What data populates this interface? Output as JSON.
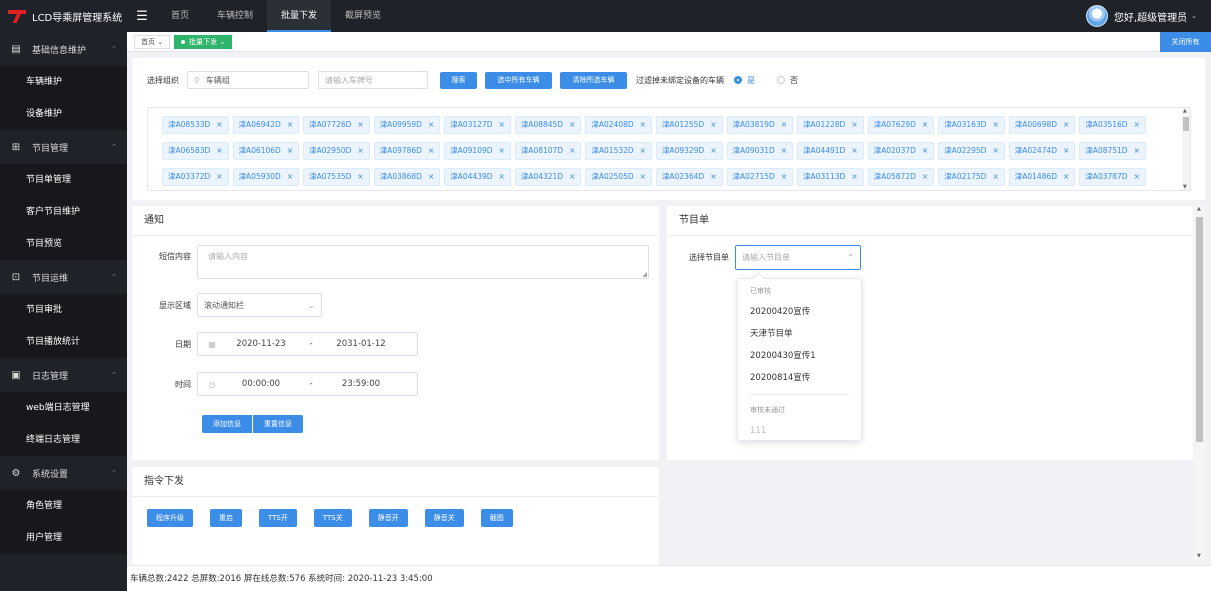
{
  "app": {
    "title": "LCD导乘屏管理系统"
  },
  "topnav": [
    "首页",
    "车辆控制",
    "批量下发",
    "截屏预览"
  ],
  "topnav_active": 2,
  "user": {
    "greeting": "您好,超级管理员"
  },
  "sidebar": [
    {
      "group": "基础信息维护",
      "icon": "document-icon",
      "items": [
        "车辆维护",
        "设备维护"
      ]
    },
    {
      "group": "节目管理",
      "icon": "bag-icon",
      "items": [
        "节目单管理",
        "客户节目维护",
        "节目预览"
      ]
    },
    {
      "group": "节目运维",
      "icon": "chart-icon",
      "items": [
        "节目审批",
        "节目播放统计"
      ]
    },
    {
      "group": "日志管理",
      "icon": "printer-icon",
      "items": [
        "web端日志管理",
        "终端日志管理"
      ]
    },
    {
      "group": "系统设置",
      "icon": "gear-icon",
      "items": [
        "角色管理",
        "用户管理"
      ]
    }
  ],
  "tabs": [
    {
      "label": "首页",
      "active": false
    },
    {
      "label": "批量下发",
      "active": true
    }
  ],
  "close_all": "关闭所有",
  "org": {
    "label": "选择组织",
    "org_value": "车辆组",
    "plate_placeholder": "请输入车牌号",
    "search_btn": "搜索",
    "select_all_btn": "选中所有车辆",
    "clear_btn": "清除所选车辆",
    "filter_label": "过滤掉未绑定设备的车辆",
    "yes": "是",
    "no": "否"
  },
  "vehicle_tags": [
    "津A08533D",
    "津A06942D",
    "津A07726D",
    "津A09959D",
    "津A03127D",
    "津A08845D",
    "津A02408D",
    "津A01255D",
    "津A03819D",
    "津A01228D",
    "津A07629D",
    "津A03163D",
    "津A00698D",
    "津A03516D",
    "津A06583D",
    "津A06106D",
    "津A02950D",
    "津A09786D",
    "津A09109D",
    "津A08107D",
    "津A01532D",
    "津A09329D",
    "津A09031D",
    "津A04491D",
    "津A02037D",
    "津A02295D",
    "津A02474D",
    "津A08751D",
    "津A03372D",
    "津A05930D",
    "津A07535D",
    "津A03868D",
    "津A04439D",
    "津A04321D",
    "津A02505D",
    "津A02364D",
    "津A02715D",
    "津A03113D",
    "津A05872D",
    "津A02175D",
    "津A01486D",
    "津A03787D"
  ],
  "notice": {
    "title": "通知",
    "sms_label": "短信内容",
    "sms_placeholder": "请输入内容",
    "area_label": "显示区域",
    "area_value": "滚动通知栏",
    "date_label": "日期",
    "date_start": "2020-11-23",
    "date_end": "2031-01-12",
    "time_label": "时间",
    "time_start": "00:00:00",
    "time_end": "23:59:00",
    "range_sep": "-",
    "add_btn": "添加信息",
    "reset_btn": "重置信息"
  },
  "program": {
    "title": "节目单",
    "select_label": "选择节目单",
    "select_placeholder": "请输入节目单",
    "groups": [
      {
        "name": "已审核",
        "options": [
          "20200420宣传",
          "天津节目单",
          "20200430宣传1",
          "20200814宣传"
        ]
      },
      {
        "name": "审核未通过",
        "options": [
          "111"
        ]
      }
    ]
  },
  "commands": {
    "title": "指令下发",
    "buttons": [
      "程序升级",
      "重启",
      "TTS开",
      "TTS关",
      "静音开",
      "静音关",
      "截图"
    ]
  },
  "footer": {
    "text": "车辆总数:2422   总屏数:2016   屏在线总数:576   系统时间: 2020-11-23 3:45:00"
  },
  "colors": {
    "primary": "#3c8de8",
    "active_tab": "#2fb46b",
    "dark": "#1f2228"
  }
}
